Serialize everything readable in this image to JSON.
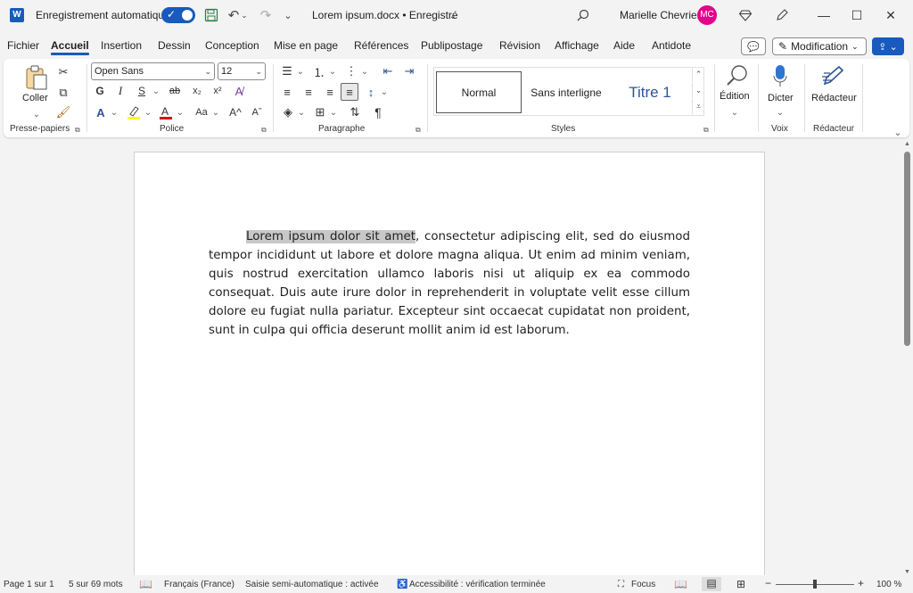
{
  "titlebar": {
    "app_icon": "word-icon",
    "app_letter": "W",
    "autosave_label": "Enregistrement automatique",
    "autosave_on": true,
    "doc_title": "Lorem ipsum.docx • Enregistré",
    "user_name": "Marielle Chevrier",
    "user_initials": "MC",
    "avatar_color": "#e3008c"
  },
  "menu": {
    "tabs": [
      {
        "label": "Fichier",
        "active": false
      },
      {
        "label": "Accueil",
        "active": true
      },
      {
        "label": "Insertion",
        "active": false
      },
      {
        "label": "Dessin",
        "active": false
      },
      {
        "label": "Conception",
        "active": false
      },
      {
        "label": "Mise en page",
        "active": false
      },
      {
        "label": "Références",
        "active": false
      },
      {
        "label": "Publipostage",
        "active": false
      },
      {
        "label": "Révision",
        "active": false
      },
      {
        "label": "Affichage",
        "active": false
      },
      {
        "label": "Aide",
        "active": false
      },
      {
        "label": "Antidote",
        "active": false
      }
    ],
    "modification_label": "Modification"
  },
  "ribbon": {
    "clipboard": {
      "paste_label": "Coller",
      "group_label": "Presse-papiers"
    },
    "font": {
      "font_name": "Open Sans",
      "font_size": "12",
      "bold": "G",
      "italic": "I",
      "underline": "S",
      "strike": "ab",
      "subscript": "x₂",
      "superscript": "x²",
      "case_label": "Aa",
      "grow": "A^",
      "shrink": "Aˇ",
      "group_label": "Police"
    },
    "paragraph": {
      "pilcrow": "¶",
      "group_label": "Paragraphe"
    },
    "styles": {
      "items": [
        "Normal",
        "Sans interligne",
        "Titre 1"
      ],
      "selected": "Normal",
      "group_label": "Styles"
    },
    "editing": {
      "label": "Édition"
    },
    "voice": {
      "dictate_label": "Dicter",
      "group_label": "Voix"
    },
    "editor": {
      "label": "Rédacteur",
      "group_label": "Rédacteur"
    }
  },
  "document": {
    "selected_text": "Lorem ipsum dolor sit amet",
    "rest_text": ", consectetur adipiscing elit, sed do eiusmod tempor incididunt ut labore et dolore magna aliqua. Ut enim ad minim veniam, quis nostrud exercitation ullamco laboris nisi ut aliquip ex ea commodo consequat. Duis aute irure dolor in reprehenderit in voluptate velit esse cillum dolore eu fugiat nulla pariatur. Excepteur sint occaecat cupidatat non proident, sunt in culpa qui officia deserunt mollit anim id est laborum."
  },
  "status": {
    "page": "Page 1 sur 1",
    "words": "5 sur 69 mots",
    "language": "Français (France)",
    "autocomplete": "Saisie semi-automatique : activée",
    "accessibility": "Accessibilité : vérification terminée",
    "focus": "Focus",
    "zoom": "100 %"
  },
  "colors": {
    "accent": "#185abd",
    "selection": "#c8c8c8",
    "titre_style": "#2f5597"
  }
}
